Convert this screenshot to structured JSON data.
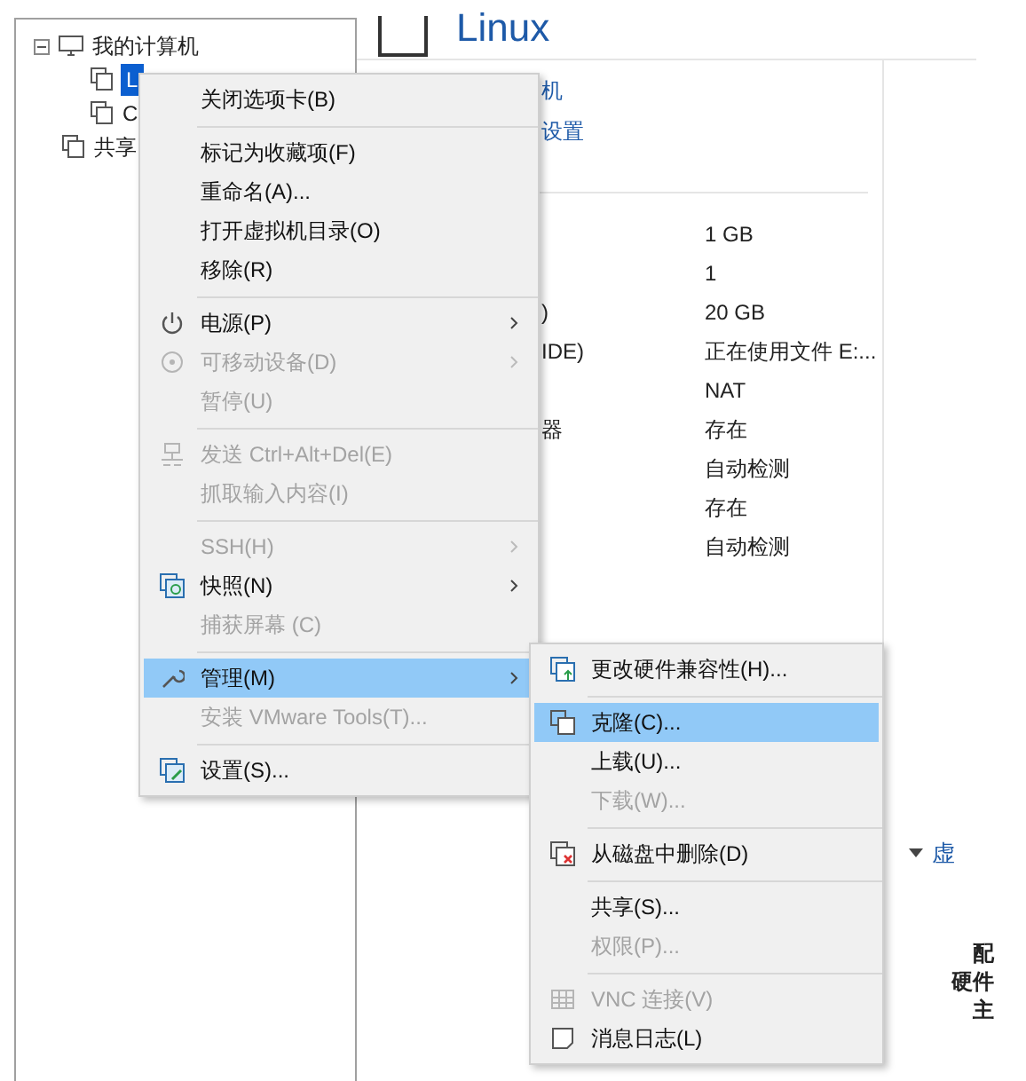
{
  "tree": {
    "root": {
      "label": "我的计算机",
      "expanded": true,
      "children": [
        {
          "label": "L",
          "selected": true
        },
        {
          "label": "C",
          "selected": false
        }
      ]
    },
    "shared": {
      "label": "共享"
    }
  },
  "vm": {
    "title": "Linux",
    "links": [
      "机",
      "设置"
    ],
    "details": [
      {
        "value": "1 GB"
      },
      {
        "value": "1"
      },
      {
        "label": ")",
        "value": "20 GB"
      },
      {
        "label": "IDE)",
        "value": "正在使用文件 E:..."
      },
      {
        "value": "NAT"
      },
      {
        "label": "器",
        "value": "存在"
      },
      {
        "value": "自动检测"
      },
      {
        "value": "存在"
      },
      {
        "value": "自动检测"
      }
    ],
    "side_section": "虚",
    "side_labels": [
      "配",
      "硬件",
      "主"
    ]
  },
  "context_menu": [
    {
      "kind": "item",
      "label": "关闭选项卡(B)",
      "disabled": false,
      "selected": false,
      "submenu": false
    },
    {
      "kind": "separator"
    },
    {
      "kind": "item",
      "label": "标记为收藏项(F)",
      "disabled": false,
      "selected": false,
      "submenu": false
    },
    {
      "kind": "item",
      "label": "重命名(A)...",
      "disabled": false,
      "selected": false,
      "submenu": false
    },
    {
      "kind": "item",
      "label": "打开虚拟机目录(O)",
      "disabled": false,
      "selected": false,
      "submenu": false
    },
    {
      "kind": "item",
      "label": "移除(R)",
      "disabled": false,
      "selected": false,
      "submenu": false
    },
    {
      "kind": "separator"
    },
    {
      "kind": "item",
      "label": "电源(P)",
      "disabled": false,
      "selected": false,
      "submenu": true
    },
    {
      "kind": "item",
      "label": "可移动设备(D)",
      "disabled": true,
      "selected": false,
      "submenu": true
    },
    {
      "kind": "item",
      "label": "暂停(U)",
      "disabled": true,
      "selected": false,
      "submenu": false
    },
    {
      "kind": "separator"
    },
    {
      "kind": "item",
      "label": "发送 Ctrl+Alt+Del(E)",
      "disabled": true,
      "selected": false,
      "submenu": false
    },
    {
      "kind": "item",
      "label": "抓取输入内容(I)",
      "disabled": true,
      "selected": false,
      "submenu": false
    },
    {
      "kind": "separator"
    },
    {
      "kind": "item",
      "label": "SSH(H)",
      "disabled": true,
      "selected": false,
      "submenu": true
    },
    {
      "kind": "item",
      "label": "快照(N)",
      "disabled": false,
      "selected": false,
      "submenu": true
    },
    {
      "kind": "item",
      "label": "捕获屏幕 (C)",
      "disabled": true,
      "selected": false,
      "submenu": false
    },
    {
      "kind": "separator"
    },
    {
      "kind": "item",
      "label": "管理(M)",
      "disabled": false,
      "selected": true,
      "submenu": true
    },
    {
      "kind": "item",
      "label": "安装 VMware Tools(T)...",
      "disabled": true,
      "selected": false,
      "submenu": false
    },
    {
      "kind": "separator"
    },
    {
      "kind": "item",
      "label": "设置(S)...",
      "disabled": false,
      "selected": false,
      "submenu": false
    }
  ],
  "submenu": [
    {
      "kind": "item",
      "label": "更改硬件兼容性(H)...",
      "disabled": false,
      "selected": false
    },
    {
      "kind": "separator"
    },
    {
      "kind": "item",
      "label": "克隆(C)...",
      "disabled": false,
      "selected": true
    },
    {
      "kind": "item",
      "label": "上载(U)...",
      "disabled": false,
      "selected": false
    },
    {
      "kind": "item",
      "label": "下载(W)...",
      "disabled": true,
      "selected": false
    },
    {
      "kind": "separator"
    },
    {
      "kind": "item",
      "label": "从磁盘中删除(D)",
      "disabled": false,
      "selected": false
    },
    {
      "kind": "separator"
    },
    {
      "kind": "item",
      "label": "共享(S)...",
      "disabled": false,
      "selected": false
    },
    {
      "kind": "item",
      "label": "权限(P)...",
      "disabled": true,
      "selected": false
    },
    {
      "kind": "separator"
    },
    {
      "kind": "item",
      "label": "VNC 连接(V)",
      "disabled": true,
      "selected": false
    },
    {
      "kind": "item",
      "label": "消息日志(L)",
      "disabled": false,
      "selected": false
    }
  ]
}
